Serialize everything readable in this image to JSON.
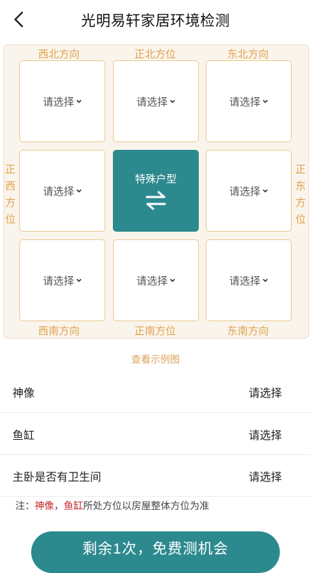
{
  "header": {
    "title": "光明易轩家居环境检测"
  },
  "grid": {
    "labels": {
      "nw": "西北方向",
      "n": "正北方位",
      "ne": "东北方向",
      "w": [
        "正",
        "西",
        "方",
        "位"
      ],
      "e": [
        "正",
        "东",
        "方",
        "位"
      ],
      "sw": "西南方向",
      "s": "正南方位",
      "se": "东南方向"
    },
    "cells": {
      "nw": "请选择",
      "n": "请选择",
      "ne": "请选择",
      "w": "请选择",
      "center": "特殊户型",
      "e": "请选择",
      "sw": "请选择",
      "s": "请选择",
      "se": "请选择"
    }
  },
  "example_link": "查看示例图",
  "rows": [
    {
      "label": "神像",
      "value": "请选择"
    },
    {
      "label": "鱼缸",
      "value": "请选择"
    },
    {
      "label": "主卧是否有卫生间",
      "value": "请选择"
    }
  ],
  "note": {
    "prefix": "注：",
    "item1": "神像",
    "sep": "，",
    "item2": "鱼缸",
    "suffix": "所处方位以房屋整体方位为准"
  },
  "cta": "剩余1次，免费测机会",
  "colors": {
    "accent": "#2c8a8f",
    "gold": "#e0a14d",
    "red": "#c8252c"
  }
}
